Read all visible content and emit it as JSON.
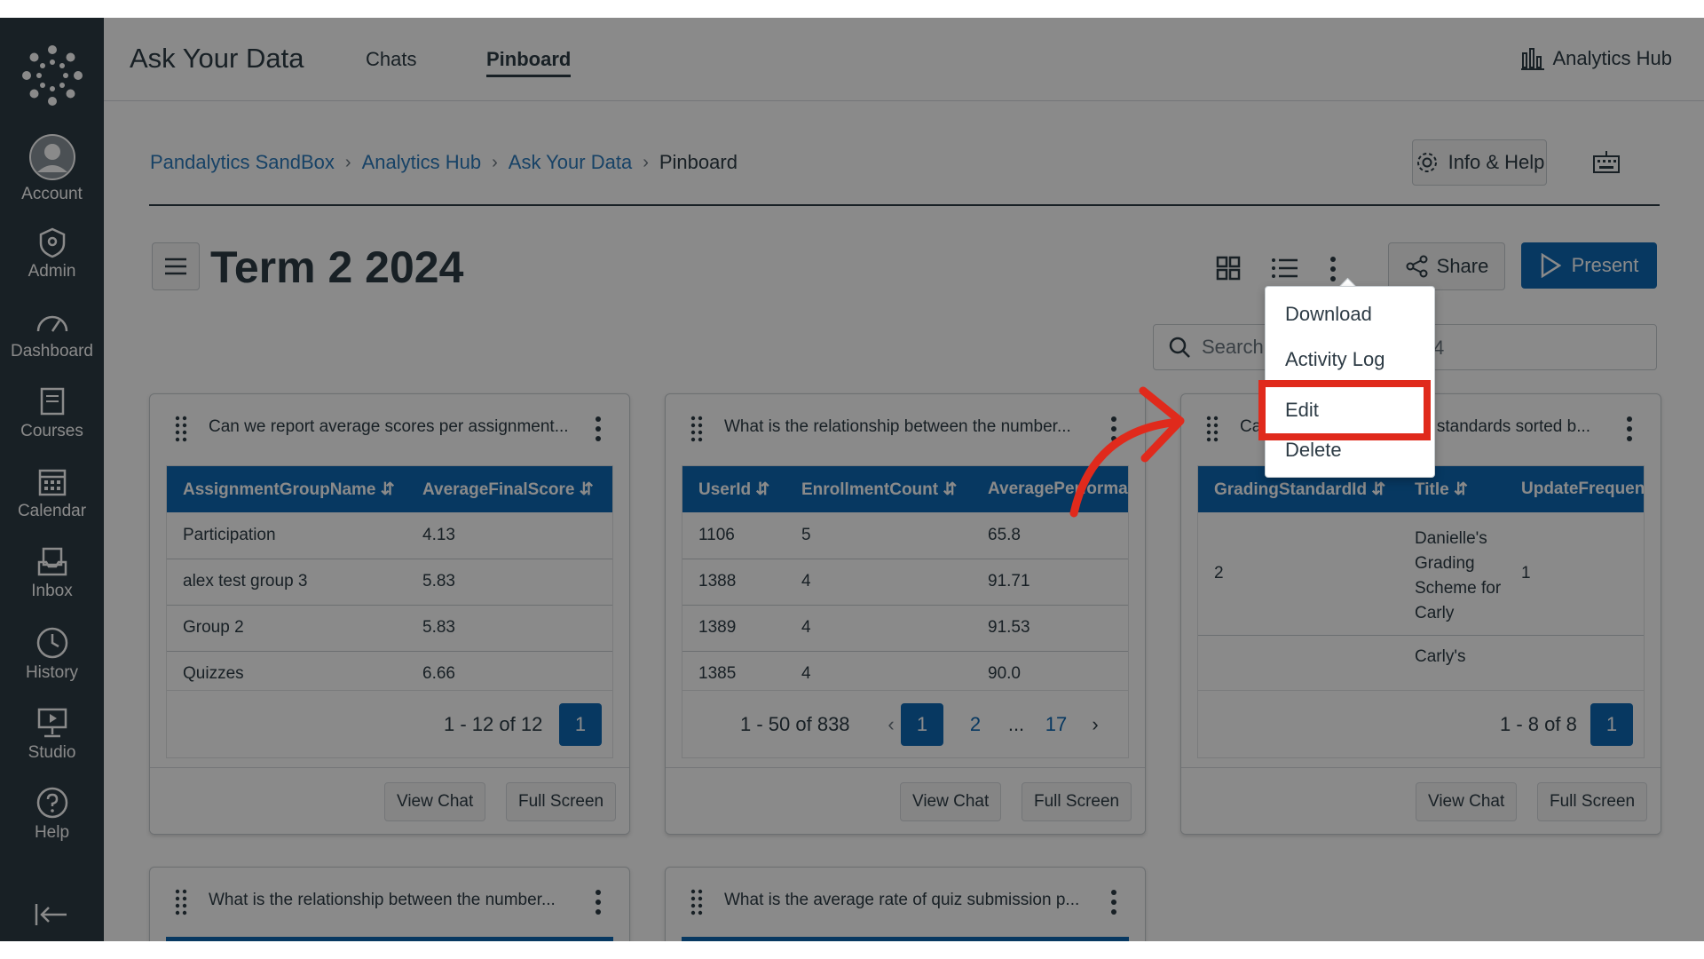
{
  "sidebar": {
    "items": [
      {
        "label": "Account",
        "icon": "account-icon"
      },
      {
        "label": "Admin",
        "icon": "admin-icon"
      },
      {
        "label": "Dashboard",
        "icon": "dashboard-icon"
      },
      {
        "label": "Courses",
        "icon": "courses-icon"
      },
      {
        "label": "Calendar",
        "icon": "calendar-icon"
      },
      {
        "label": "Inbox",
        "icon": "inbox-icon"
      },
      {
        "label": "History",
        "icon": "history-icon"
      },
      {
        "label": "Studio",
        "icon": "studio-icon"
      },
      {
        "label": "Help",
        "icon": "help-icon"
      }
    ]
  },
  "topbar": {
    "title": "Ask Your Data",
    "tabs": [
      {
        "label": "Chats"
      },
      {
        "label": "Pinboard"
      }
    ],
    "hub_link": "Analytics Hub"
  },
  "breadcrumb": [
    "Pandalytics SandBox",
    "Analytics Hub",
    "Ask Your Data",
    "Pinboard"
  ],
  "toolbar": {
    "info_help": "Info & Help",
    "page_title": "Term 2 2024",
    "share": "Share",
    "present": "Present",
    "search_placeholder": "Search",
    "search_trailing": "4"
  },
  "dropdown": {
    "items": [
      "Download",
      "Activity Log",
      "Edit",
      "Delete"
    ]
  },
  "cards": [
    {
      "title": "Can we report average scores per assignment...",
      "headers": [
        "AssignmentGroupName",
        "AverageFinalScore"
      ],
      "rows": [
        [
          "Participation",
          "4.13"
        ],
        [
          "alex test group 3",
          "5.83"
        ],
        [
          "Group 2",
          "5.83"
        ],
        [
          "Quizzes",
          "6.66"
        ]
      ],
      "page_count": "1 - 12 of 12",
      "pages": [
        "1"
      ],
      "view_chat": "View Chat",
      "full_screen": "Full Screen"
    },
    {
      "title": "What is the relationship between the number...",
      "headers": [
        "UserId",
        "EnrollmentCount",
        "AveragePerforma"
      ],
      "rows": [
        [
          "1106",
          "5",
          "65.8"
        ],
        [
          "1388",
          "4",
          "91.71"
        ],
        [
          "1389",
          "4",
          "91.53"
        ],
        [
          "1385",
          "4",
          "90.0"
        ]
      ],
      "page_count": "1 - 50 of 838",
      "pages": [
        "1",
        "2",
        "...",
        "17"
      ],
      "view_chat": "View Chat",
      "full_screen": "Full Screen"
    },
    {
      "title_visible_start": "Ca",
      "title_visible_end": "g standards sorted b...",
      "headers": [
        "GradingStandardId",
        "Title",
        "UpdateFrequen"
      ],
      "rows": [
        [
          "2",
          "Danielle's Grading Scheme for Carly",
          "1"
        ],
        [
          "",
          "Carly's",
          ""
        ]
      ],
      "page_count": "1 - 8 of 8",
      "pages": [
        "1"
      ],
      "view_chat": "View Chat",
      "full_screen": "Full Screen"
    },
    {
      "title": "What is the relationship between the number..."
    },
    {
      "title": "What is the average rate of quiz submission p..."
    }
  ],
  "colors": {
    "sidebar": "#2d3b45",
    "accent": "#0e68b3",
    "highlight": "#e02a1c"
  }
}
